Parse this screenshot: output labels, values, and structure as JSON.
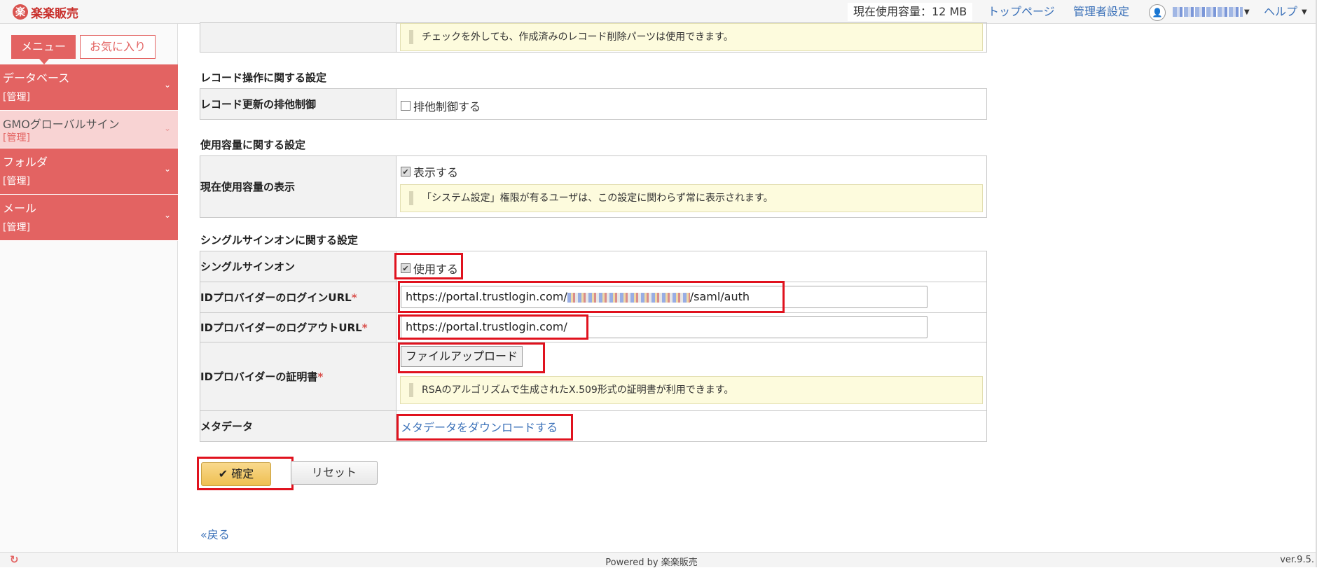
{
  "header": {
    "logo_text": "楽楽販売",
    "logo_mark": "楽",
    "usage": "現在使用容量：12 MB",
    "links": {
      "top": "トップページ",
      "admin": "管理者設定",
      "help": "ヘルプ"
    }
  },
  "sidebar": {
    "tabs": {
      "menu": "メニュー",
      "favorites": "お気に入り"
    },
    "items": [
      {
        "label": "データベース",
        "sub": "[管理]"
      },
      {
        "label": "GMOグローバルサイン",
        "sub": "[管理]"
      },
      {
        "label": "フォルダ",
        "sub": "[管理]"
      },
      {
        "label": "メール",
        "sub": "[管理]"
      }
    ]
  },
  "top_notice": "チェックを外しても、作成済みのレコード削除パーツは使用できます。",
  "sections": {
    "record_ops": {
      "title": "レコード操作に関する設定",
      "row_label": "レコード更新の排他制御",
      "checkbox_label": "排他制御する",
      "checked": false
    },
    "usage": {
      "title": "使用容量に関する設定",
      "row_label": "現在使用容量の表示",
      "checkbox_label": "表示する",
      "checked": true,
      "notice": "「システム設定」権限が有るユーザは、この設定に関わらず常に表示されます。"
    },
    "sso": {
      "title": "シングルサインオンに関する設定",
      "enable_label": "シングルサインオン",
      "enable_checkbox": "使用する",
      "enable_checked": true,
      "login_label": "IDプロバイダーのログインURL",
      "login_url_prefix": "https://portal.trustlogin.com/",
      "login_url_suffix": "/saml/auth",
      "logout_label": "IDプロバイダーのログアウトURL",
      "logout_url": "https://portal.trustlogin.com/",
      "cert_label": "IDプロバイダーの証明書",
      "upload_button": "ファイルアップロード",
      "cert_notice": "RSAのアルゴリズムで生成されたX.509形式の証明書が利用できます。",
      "metadata_label": "メタデータ",
      "metadata_link": "メタデータをダウンロードする",
      "required_mark": "*"
    }
  },
  "actions": {
    "confirm": "確定",
    "reset": "リセット",
    "back": "«戻る"
  },
  "footer": {
    "powered": "Powered by 楽楽販売",
    "version": "ver.9.5."
  },
  "colors": {
    "accent": "#e36362",
    "highlight": "#e0121e",
    "link": "#3a70b8",
    "notice_bg": "#fdfbdd"
  }
}
